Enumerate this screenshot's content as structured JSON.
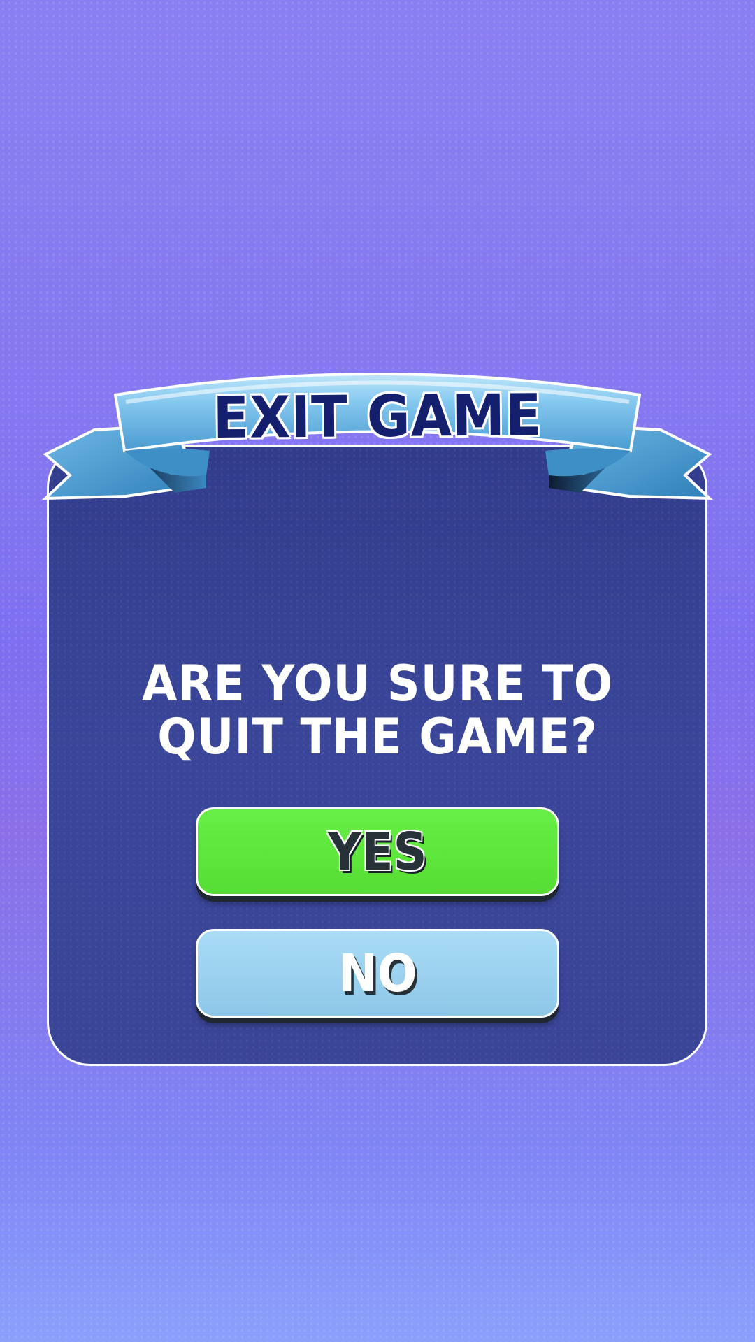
{
  "dialog": {
    "title": "EXIT GAME",
    "question_line1": "ARE YOU SURE TO",
    "question_line2": "QUIT THE GAME?",
    "yes_label": "YES",
    "no_label": "NO"
  },
  "colors": {
    "background": "#8578f0",
    "panel": "#3a4598",
    "ribbon": "#5fb3e0",
    "title_text": "#141f6e",
    "yes_button": "#5de53a",
    "no_button": "#9bd1ef"
  },
  "icons": {
    "ribbon": "banner-ribbon"
  }
}
